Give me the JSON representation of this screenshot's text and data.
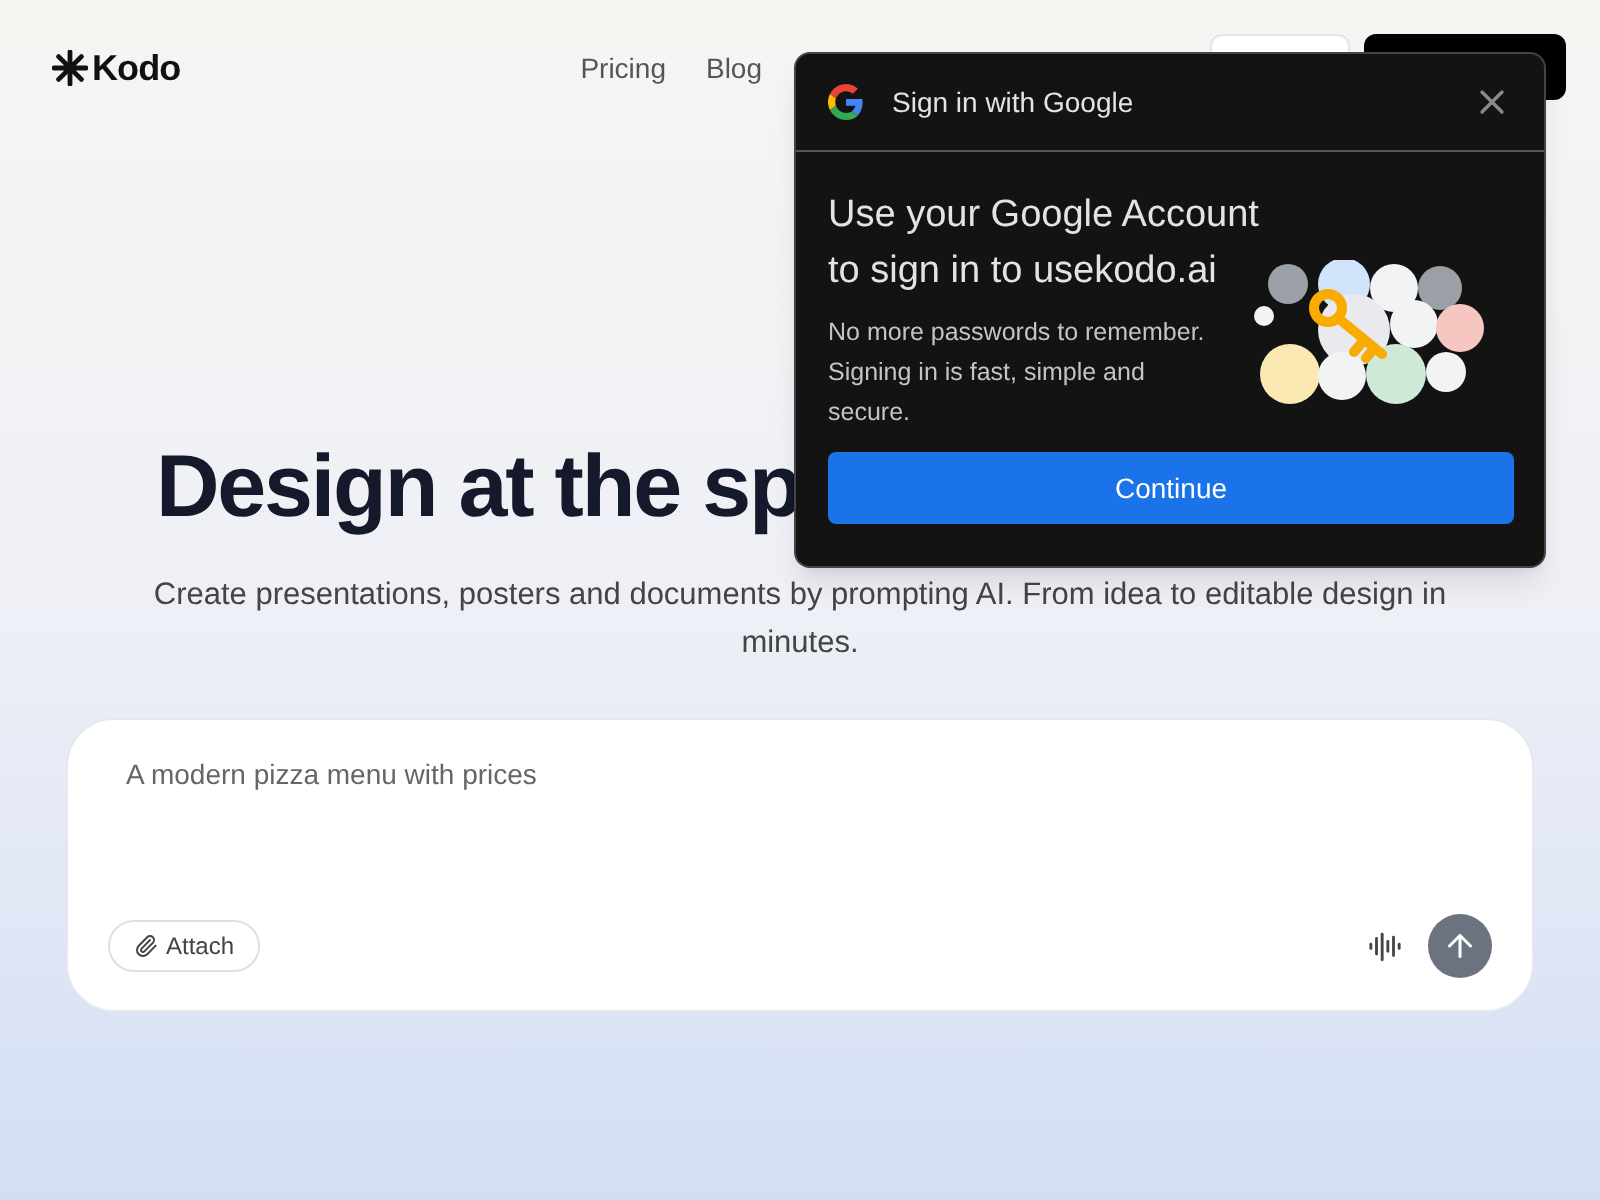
{
  "header": {
    "logo": "Kodo",
    "nav": [
      "Pricing",
      "Blog"
    ]
  },
  "hero": {
    "title": "Design at the sp",
    "subtitle": "Create presentations, posters and documents by prompting AI. From idea to editable design in minutes."
  },
  "prompt": {
    "placeholder": "A modern pizza menu with prices",
    "attach": "Attach"
  },
  "google_popup": {
    "title": "Sign in with Google",
    "heading": "Use your Google Account to sign in to usekodo.ai",
    "body": "No more passwords to remember. Signing in is fast, simple and secure.",
    "button": "Continue"
  }
}
